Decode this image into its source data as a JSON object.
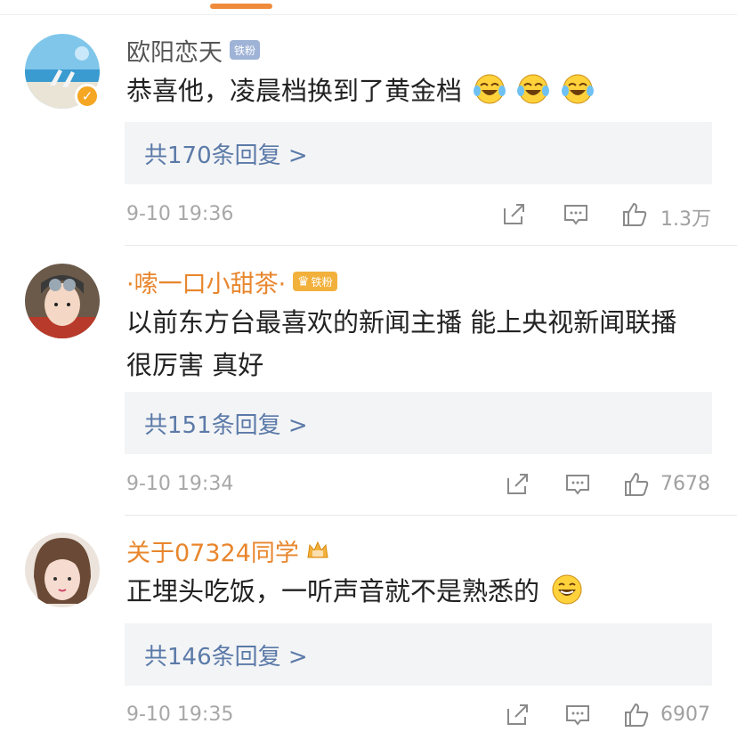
{
  "comments": [
    {
      "username": "欧阳恋天",
      "fan_badge": "铁粉",
      "text": "恭喜他，凌晨档换到了黄金档",
      "emoji": [
        "laugh-cry-emoji",
        "laugh-cry-emoji",
        "laugh-cry-emoji"
      ],
      "replies": "共170条回复 >",
      "time": "9-10 19:36",
      "likes": "1.3万"
    },
    {
      "username": "·嗦一口小甜茶·",
      "fan_badge": "铁粉",
      "text_line1": "以前东方台最喜欢的新闻主播 能上央视新闻联播",
      "text_line2": "很厉害 真好",
      "replies": "共151条回复 >",
      "time": "9-10 19:34",
      "likes": "7678"
    },
    {
      "username": "关于07324同学",
      "text": "正埋头吃饭，一听声音就不是熟悉的",
      "emoji": [
        "laugh-emoji"
      ],
      "replies": "共146条回复 >",
      "time": "9-10 19:35",
      "likes": "6907"
    }
  ],
  "colors": {
    "accent_orange": "#e8862d",
    "reply_link": "#5b7aa8",
    "reply_bg": "#f3f4f6",
    "verified_badge": "#f5a623"
  },
  "icons": [
    "share-icon",
    "comment-icon",
    "like-icon",
    "verified-icon",
    "crown-icon"
  ]
}
